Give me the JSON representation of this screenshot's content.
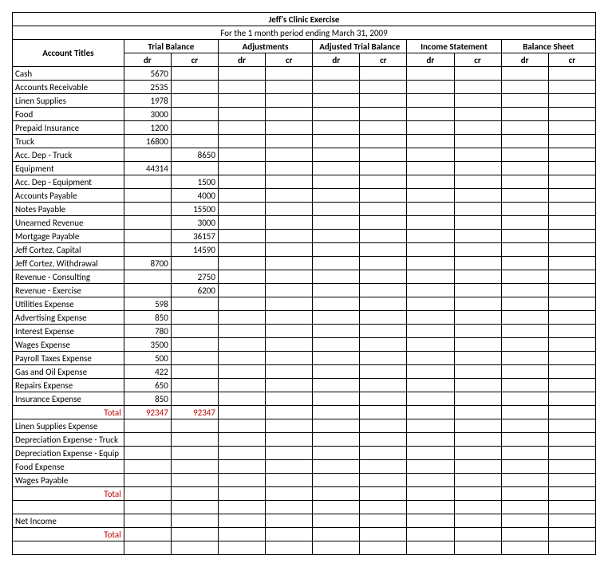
{
  "title": "Jeff's Clinic Exercise",
  "subtitle": "For the 1 month period ending March 31, 2009",
  "headers": {
    "account_titles": "Account Titles",
    "trial_balance": "Trial Balance",
    "adjustments": "Adjustments",
    "adjusted_trial_balance": "Adjusted Trial Balance",
    "income_statement": "Income Statement",
    "balance_sheet": "Balance Sheet",
    "dr": "dr",
    "cr": "cr"
  },
  "rows": [
    {
      "acct": "Cash",
      "tb_dr": "5670",
      "tb_cr": ""
    },
    {
      "acct": "Accounts Receivable",
      "tb_dr": "2535",
      "tb_cr": ""
    },
    {
      "acct": "Linen Supplies",
      "tb_dr": "1978",
      "tb_cr": ""
    },
    {
      "acct": "Food",
      "tb_dr": "3000",
      "tb_cr": ""
    },
    {
      "acct": "Prepaid Insurance",
      "tb_dr": "1200",
      "tb_cr": ""
    },
    {
      "acct": "Truck",
      "tb_dr": "16800",
      "tb_cr": ""
    },
    {
      "acct": "Acc. Dep - Truck",
      "tb_dr": "",
      "tb_cr": "8650"
    },
    {
      "acct": "Equipment",
      "tb_dr": "44314",
      "tb_cr": ""
    },
    {
      "acct": "Acc. Dep - Equipment",
      "tb_dr": "",
      "tb_cr": "1500"
    },
    {
      "acct": "Accounts Payable",
      "tb_dr": "",
      "tb_cr": "4000"
    },
    {
      "acct": "Notes Payable",
      "tb_dr": "",
      "tb_cr": "15500"
    },
    {
      "acct": "Unearned Revenue",
      "tb_dr": "",
      "tb_cr": "3000"
    },
    {
      "acct": "Mortgage Payable",
      "tb_dr": "",
      "tb_cr": "36157"
    },
    {
      "acct": "Jeff Cortez, Capital",
      "tb_dr": "",
      "tb_cr": "14590"
    },
    {
      "acct": "Jeff Cortez, Withdrawal",
      "tb_dr": "8700",
      "tb_cr": ""
    },
    {
      "acct": "Revenue - Consulting",
      "tb_dr": "",
      "tb_cr": "2750"
    },
    {
      "acct": "Revenue - Exercise",
      "tb_dr": "",
      "tb_cr": "6200"
    },
    {
      "acct": "Utilities Expense",
      "tb_dr": "598",
      "tb_cr": ""
    },
    {
      "acct": "Advertising Expense",
      "tb_dr": "850",
      "tb_cr": ""
    },
    {
      "acct": "Interest Expense",
      "tb_dr": "780",
      "tb_cr": ""
    },
    {
      "acct": "Wages Expense",
      "tb_dr": "3500",
      "tb_cr": ""
    },
    {
      "acct": "Payroll Taxes Expense",
      "tb_dr": "500",
      "tb_cr": ""
    },
    {
      "acct": "Gas and Oil Expense",
      "tb_dr": "422",
      "tb_cr": ""
    },
    {
      "acct": "Repairs Expense",
      "tb_dr": "650",
      "tb_cr": ""
    },
    {
      "acct": "Insurance Expense",
      "tb_dr": "850",
      "tb_cr": ""
    }
  ],
  "total1": {
    "label": "Total",
    "tb_dr": "92347",
    "tb_cr": "92347"
  },
  "rows2": [
    {
      "acct": "Linen Supplies Expense"
    },
    {
      "acct": "Depreciation Expense - Truck"
    },
    {
      "acct": "Depreciation Expense - Equip"
    },
    {
      "acct": "Food Expense"
    },
    {
      "acct": "Wages Payable"
    }
  ],
  "total2": {
    "label": "Total"
  },
  "net_income": {
    "label": "Net Income"
  },
  "total3": {
    "label": "Total"
  }
}
